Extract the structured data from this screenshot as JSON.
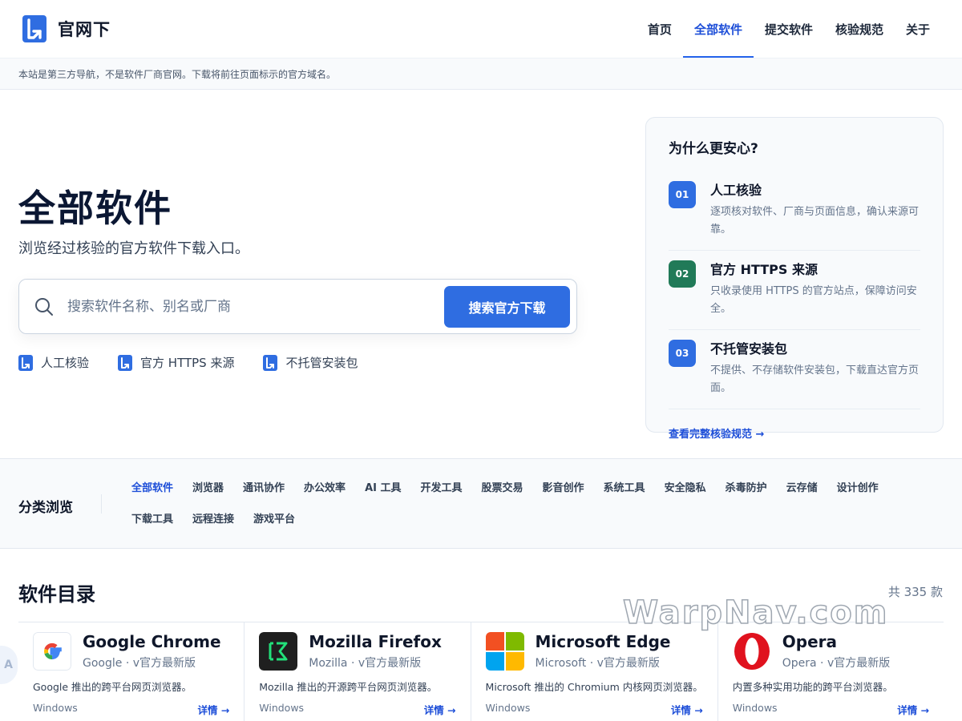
{
  "brand": {
    "name": "官网下"
  },
  "nav": {
    "items": [
      {
        "label": "首页"
      },
      {
        "label": "全部软件"
      },
      {
        "label": "提交软件"
      },
      {
        "label": "核验规范"
      },
      {
        "label": "关于"
      }
    ]
  },
  "notice": "本站是第三方导航，不是软件厂商官网。下载将前往页面标示的官方域名。",
  "hero": {
    "title": "全部软件",
    "subtitle": "浏览经过核验的官方软件下载入口。",
    "search_placeholder": "搜索软件名称、别名或厂商",
    "search_button": "搜索官方下载",
    "features": [
      "人工核验",
      "官方 HTTPS 来源",
      "不托管安装包"
    ]
  },
  "why": {
    "title": "为什么更安心?",
    "items": [
      {
        "num": "01",
        "title": "人工核验",
        "desc": "逐项核对软件、厂商与页面信息，确认来源可靠。"
      },
      {
        "num": "02",
        "title": "官方 HTTPS 来源",
        "desc": "只收录使用 HTTPS 的官方站点，保障访问安全。"
      },
      {
        "num": "03",
        "title": "不托管安装包",
        "desc": "不提供、不存储软件安装包，下载直达官方页面。"
      }
    ],
    "link": "查看完整核验规范 →"
  },
  "categories": {
    "label": "分类浏览",
    "items": [
      "全部软件",
      "浏览器",
      "通讯协作",
      "办公效率",
      "AI 工具",
      "开发工具",
      "股票交易",
      "影音创作",
      "系统工具",
      "安全隐私",
      "杀毒防护",
      "云存储",
      "设计创作",
      "下载工具",
      "远程连接",
      "游戏平台"
    ]
  },
  "catalog": {
    "title": "软件目录",
    "count": "共 335 款",
    "cards": [
      {
        "name": "Google Chrome",
        "vendor": "Google",
        "version": "v官方最新版",
        "desc": "Google 推出的跨平台网页浏览器。",
        "platform": "Windows",
        "link": "详情 →"
      },
      {
        "name": "Mozilla Firefox",
        "vendor": "Mozilla",
        "version": "v官方最新版",
        "desc": "Mozilla 推出的开源跨平台网页浏览器。",
        "platform": "Windows",
        "link": "详情 →"
      },
      {
        "name": "Microsoft Edge",
        "vendor": "Microsoft",
        "version": "v官方最新版",
        "desc": "Microsoft 推出的 Chromium 内核网页浏览器。",
        "platform": "Windows",
        "link": "详情 →"
      },
      {
        "name": "Opera",
        "vendor": "Opera",
        "version": "v官方最新版",
        "desc": "内置多种实用功能的跨平台浏览器。",
        "platform": "Windows",
        "link": "详情 →"
      }
    ]
  },
  "watermark": "WarpNav.com",
  "side_tab": "A",
  "colors": {
    "accent": "#2f6de1",
    "green": "#217a58",
    "nav_active": "#1d4ed8"
  }
}
